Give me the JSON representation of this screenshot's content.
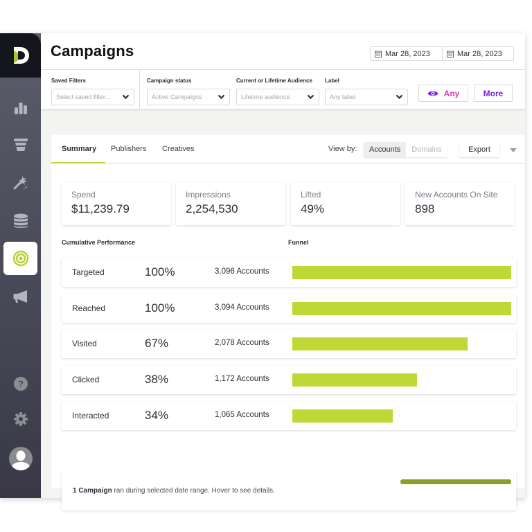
{
  "header": {
    "title": "Campaigns",
    "date_start": "Mar 28, 2023",
    "date_end": "Mar 28, 2023"
  },
  "sidebar": {
    "items": [
      {
        "name": "analytics",
        "icon": "bar-chart-icon",
        "active": false
      },
      {
        "name": "funnel",
        "icon": "funnel-icon",
        "active": false
      },
      {
        "name": "magic",
        "icon": "magic-wand-icon",
        "active": false
      },
      {
        "name": "data",
        "icon": "database-icon",
        "active": false
      },
      {
        "name": "campaigns",
        "icon": "target-icon",
        "active": true
      },
      {
        "name": "announcements",
        "icon": "megaphone-icon",
        "active": false
      }
    ],
    "bottom": [
      {
        "name": "help",
        "icon": "help-icon"
      },
      {
        "name": "settings",
        "icon": "gear-icon"
      },
      {
        "name": "profile",
        "icon": "avatar-icon"
      }
    ]
  },
  "filters": {
    "saved_filters": {
      "label": "Saved Filters",
      "placeholder": "Select saved filter..."
    },
    "campaign_status": {
      "label": "Campaign status",
      "value": "Active Campaigns"
    },
    "audience": {
      "label": "Current or Lifetime Audience",
      "value": "Lifetime audience"
    },
    "label": {
      "label": "Label",
      "value": "Any label"
    },
    "visibility_button": "Any",
    "more_button": "More"
  },
  "colors": {
    "accent_green": "#c0d836",
    "dark_green": "#8d9f2a",
    "purple": "#7a1fe0",
    "pink": "#d63ea9"
  },
  "tabs": [
    {
      "label": "Summary",
      "active": true
    },
    {
      "label": "Publishers",
      "active": false
    },
    {
      "label": "Creatives",
      "active": false
    }
  ],
  "view_by": {
    "label": "View by:",
    "options": [
      {
        "label": "Accounts",
        "selected": true
      },
      {
        "label": "Domains",
        "selected": false
      }
    ]
  },
  "export_label": "Export",
  "stats": [
    {
      "label": "Spend",
      "value": "$11,239.79"
    },
    {
      "label": "Impressions",
      "value": "2,254,530"
    },
    {
      "label": "Lifted",
      "value": "49%"
    },
    {
      "label": "New Accounts On Site",
      "value": "898"
    }
  ],
  "cumulative_label": "Cumulative Performance",
  "funnel_label": "Funnel",
  "funnel": [
    {
      "stage": "Targeted",
      "percent": "100%",
      "accounts": "3,096 Accounts",
      "bar_fill": 1.0
    },
    {
      "stage": "Reached",
      "percent": "100%",
      "accounts": "3,094 Accounts",
      "bar_fill": 1.0
    },
    {
      "stage": "Visited",
      "percent": "67%",
      "accounts": "2,078 Accounts",
      "bar_fill": 0.8
    },
    {
      "stage": "Clicked",
      "percent": "38%",
      "accounts": "1,172 Accounts",
      "bar_fill": 0.57
    },
    {
      "stage": "Interacted",
      "percent": "34%",
      "accounts": "1,065 Accounts",
      "bar_fill": 0.46
    }
  ],
  "campaign_summary": {
    "count_label": "1 Campaign",
    "text": " ran during selected date range. Hover to see details."
  }
}
